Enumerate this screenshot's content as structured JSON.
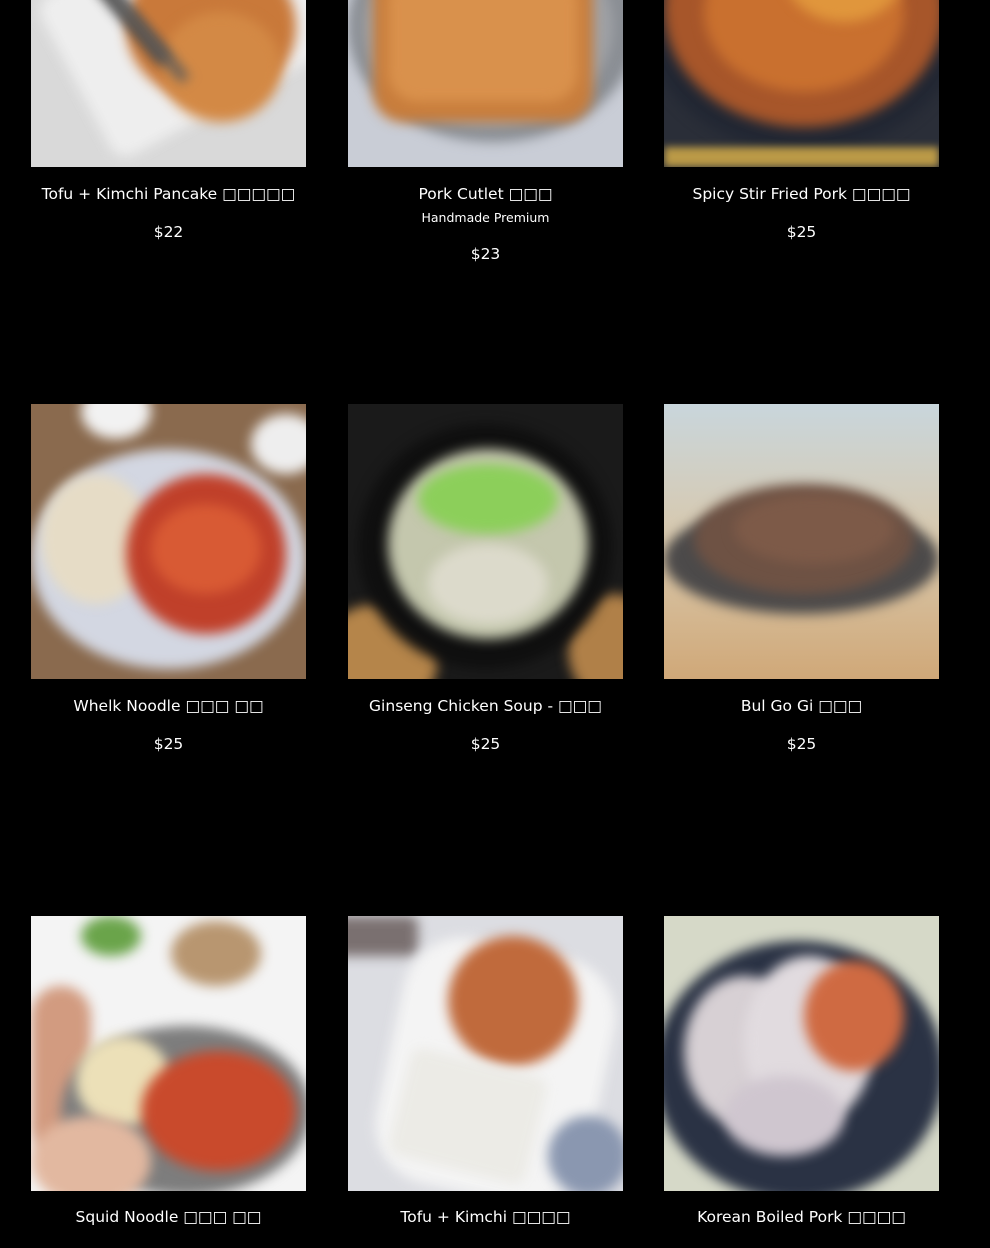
{
  "menu": {
    "items": [
      {
        "name": "Tofu + Kimchi Pancake □□□□□",
        "subtitle": "",
        "price": "$22",
        "image": "pancake-on-white-plate"
      },
      {
        "name": "Pork Cutlet □□□",
        "subtitle": "Handmade Premium",
        "price": "$23",
        "image": "breaded-pork-cutlet"
      },
      {
        "name": "Spicy Stir Fried Pork □□□□",
        "subtitle": "",
        "price": "$25",
        "image": "spicy-pork-in-black-bowl"
      },
      {
        "name": "Whelk Noodle □□□ □□",
        "subtitle": "",
        "price": "$25",
        "image": "whelk-noodle-plate"
      },
      {
        "name": "Ginseng Chicken Soup - □□□",
        "subtitle": "",
        "price": "$25",
        "image": "chicken-soup-in-stone-pot"
      },
      {
        "name": "Bul Go Gi □□□",
        "subtitle": "",
        "price": "$25",
        "image": "bulgogi-beef-plate"
      },
      {
        "name": "Squid Noodle □□□ □□",
        "subtitle": "",
        "price": "",
        "image": "squid-noodle-plate"
      },
      {
        "name": "Tofu + Kimchi □□□□",
        "subtitle": "",
        "price": "",
        "image": "tofu-with-kimchi-plate"
      },
      {
        "name": "Korean Boiled Pork □□□□",
        "subtitle": "",
        "price": "",
        "image": "boiled-pork-slices"
      }
    ]
  },
  "colors": {
    "background": "#000000",
    "text": "#ffffff"
  }
}
